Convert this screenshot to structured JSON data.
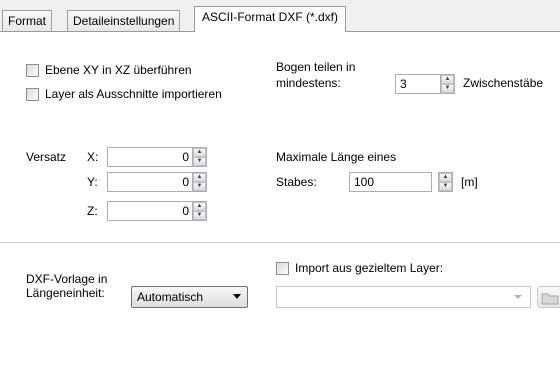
{
  "tabs": [
    {
      "label": "Format"
    },
    {
      "label": "Detaileinstellungen"
    },
    {
      "label": "ASCII-Format DXF (*.dxf)"
    }
  ],
  "options": {
    "plane_xy_to_xz": {
      "label": "Ebene XY in XZ überführen",
      "checked": false
    },
    "layers_as_cutouts": {
      "label": "Layer als Ausschnitte importieren",
      "checked": false
    }
  },
  "arc": {
    "label_line1": "Bogen teilen in",
    "label_line2": "mindestens:",
    "value": "3",
    "unit": "Zwischenstäbe"
  },
  "offset": {
    "label": "Versatz",
    "x_label": "X:",
    "x_value": "0",
    "y_label": "Y:",
    "y_value": "0",
    "z_label": "Z:",
    "z_value": "0"
  },
  "max_length": {
    "label_line1": "Maximale Länge eines",
    "label_line2": "Stabes:",
    "value": "100",
    "unit": "[m]"
  },
  "dxf_template": {
    "label_line1": "DXF-Vorlage in",
    "label_line2": "Längeneinheit:",
    "selected": "Automatisch"
  },
  "layer_import": {
    "label": "Import aus gezieltem Layer:",
    "checked": false,
    "value": ""
  }
}
